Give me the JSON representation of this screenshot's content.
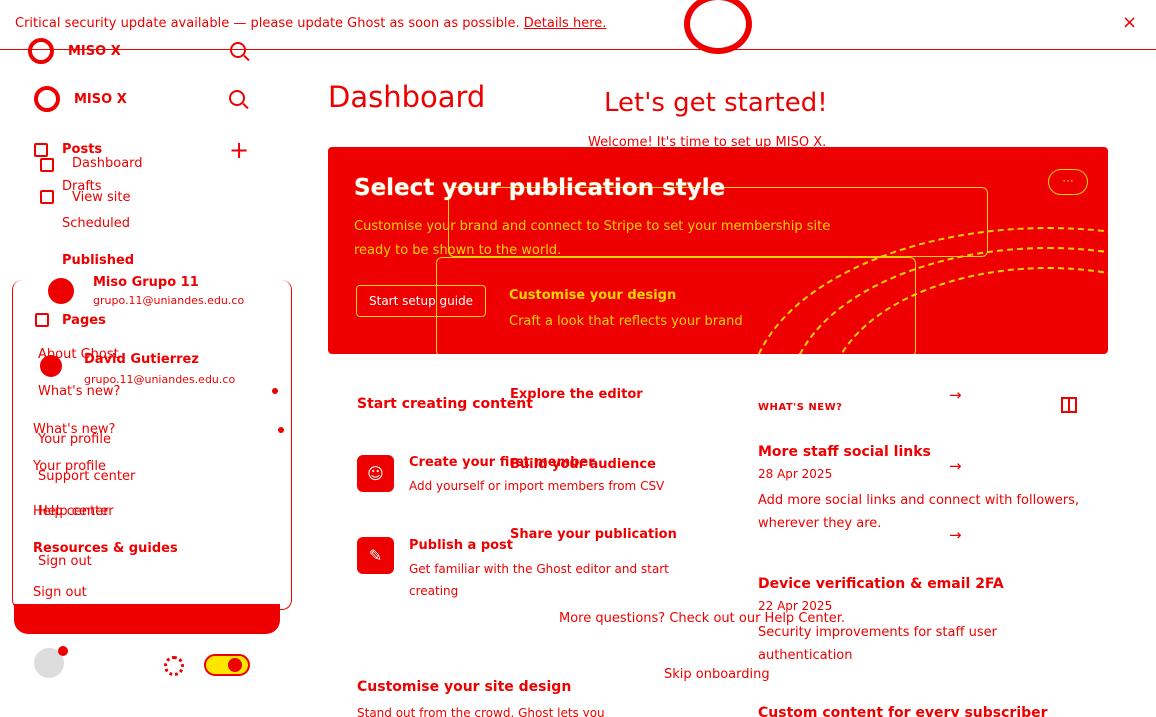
{
  "banner": {
    "text": "Critical security update available — please update Ghost as soon as possible.",
    "link": "Details here.",
    "close": "×"
  },
  "sidebar": {
    "brand_top": "MISO X",
    "brand": "MISO X",
    "posts": "Posts",
    "dashboard": "Dashboard",
    "drafts": "Drafts",
    "view_site": "View site",
    "scheduled": "Scheduled",
    "published": "Published",
    "pages": "Pages",
    "about_ghost": "About Ghost",
    "whats_new": "What's new?",
    "your_profile": "Your profile",
    "support_center": "Support center",
    "help_center": "Help center",
    "sign_out": "Sign out"
  },
  "accounts": [
    {
      "name": "Miso Grupo 11",
      "email": "grupo.11@uniandes.edu.co"
    },
    {
      "name": "David Gutierrez",
      "email": "grupo.11@uniandes.edu.co"
    }
  ],
  "menu": {
    "whats_new": "What's new?",
    "your_profile": "Your profile",
    "help_center": "Help center",
    "resources": "Resources & guides",
    "sign_out": "Sign out"
  },
  "main": {
    "title": "Dashboard",
    "lets_start": "Let's get started!",
    "welcome": "Welcome! It's time to set up MISO X."
  },
  "hero": {
    "title": "Select your publication style",
    "description": "Customise your brand and connect to Stripe to set your membership site ready to be shown to the world.",
    "button": "Start setup guide",
    "card_title": "Customise your design",
    "card_desc": "Craft a look that reflects your brand",
    "more": "···"
  },
  "start_creating": {
    "title": "Start creating content",
    "items": [
      {
        "title": "Create your first member",
        "desc": "Add yourself or import members from CSV"
      },
      {
        "title": "Publish a post",
        "desc": "Get familiar with the Ghost editor and start creating"
      }
    ]
  },
  "onboarding": {
    "explore_editor": "Explore the editor",
    "build_audience": "Build your audience",
    "share_publication": "Share your publication",
    "help": "More questions? Check out our Help Center.",
    "skip": "Skip onboarding"
  },
  "whats_new": {
    "label": "WHAT'S NEW?",
    "items": [
      {
        "title": "More staff social links",
        "date": "28 Apr 2025",
        "body": "Add more social links and connect with followers, wherever they are."
      },
      {
        "title": "Device verification & email 2FA",
        "date": "22 Apr 2025",
        "body": "Security improvements for staff user authentication"
      },
      {
        "title": "Custom content for every subscriber"
      }
    ]
  },
  "customise": {
    "title": "Customise your site design",
    "desc": "Stand out from the crowd. Ghost lets you"
  }
}
